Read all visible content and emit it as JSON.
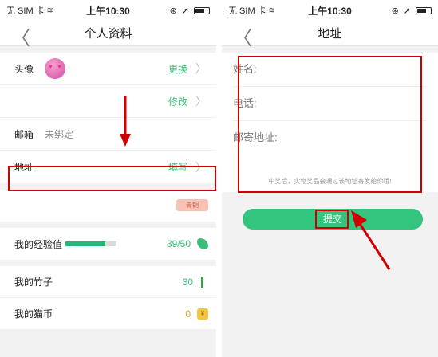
{
  "left": {
    "status": {
      "carrier": "无 SIM 卡",
      "time": "上午10:30"
    },
    "nav": {
      "back": "〈",
      "title": "个人资料"
    },
    "avatar_row": {
      "label": "头像",
      "action": "更换"
    },
    "phone_row": {
      "label": "",
      "action": "修改"
    },
    "email_row": {
      "label": "邮箱",
      "value": "未绑定"
    },
    "address_row": {
      "label": "地址",
      "action": "填写"
    },
    "badge": "青铜",
    "exp": {
      "label": "我的经验值",
      "value": "39/50",
      "progress": 0.78
    },
    "bamboo": {
      "label": "我的竹子",
      "value": "30"
    },
    "coins": {
      "label": "我的猫币",
      "value": "0"
    }
  },
  "right": {
    "status": {
      "carrier": "无 SIM 卡",
      "time": "上午10:30"
    },
    "nav": {
      "back": "〈",
      "title": "地址"
    },
    "fields": {
      "name": "姓名:",
      "phone": "电话:",
      "address": "邮寄地址:"
    },
    "note": "中奖后，实物奖品会通过该地址寄发给你哦!",
    "submit": "提交"
  },
  "colors": {
    "accent": "#38c47a",
    "highlight": "#d10000"
  }
}
